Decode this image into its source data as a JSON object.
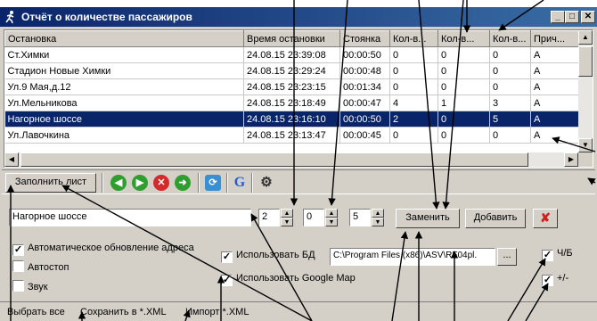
{
  "window": {
    "title": "Отчёт о количестве пассажиров"
  },
  "grid": {
    "columns": [
      "Остановка",
      "Время остановки",
      "Стоянка",
      "Кол-в...",
      "Кол-в...",
      "Кол-в...",
      "Прич..."
    ],
    "rows": [
      [
        "Ст.Химки",
        "24.08.15 23:39:08",
        "00:00:50",
        "0",
        "0",
        "0",
        "A"
      ],
      [
        "Стадион Новые Химки",
        "24.08.15 23:29:24",
        "00:00:48",
        "0",
        "0",
        "0",
        "A"
      ],
      [
        "Ул.9 Мая,д.12",
        "24.08.15 23:23:15",
        "00:01:34",
        "0",
        "0",
        "0",
        "A"
      ],
      [
        "Ул.Мельникова",
        "24.08.15 23:18:49",
        "00:00:47",
        "4",
        "1",
        "3",
        "A"
      ],
      [
        "Нагорное шоссе",
        "24.08.15 23:16:10",
        "00:00:50",
        "2",
        "0",
        "5",
        "A"
      ],
      [
        "Ул.Лавочкина",
        "24.08.15 23:13:47",
        "00:00:45",
        "0",
        "0",
        "0",
        "A"
      ]
    ],
    "selected_row": 4
  },
  "toolbar": {
    "fill_sheet_label": "Заполнить лист",
    "google_letter": "G"
  },
  "form": {
    "stop_name": "Нагорное шоссе",
    "spin1": "2",
    "spin2": "0",
    "spin3": "5",
    "replace_label": "Заменить",
    "add_label": "Добавить",
    "delete_glyph": "✘",
    "db_path": "C:\\Program Files (x86)\\ASV\\RF04pl.",
    "browse_label": "..."
  },
  "options": {
    "auto_update": {
      "label": "Автоматическое обновление адреса",
      "checked": true
    },
    "autostop": {
      "label": "Автостоп",
      "checked": false
    },
    "sound": {
      "label": "Звук",
      "checked": false
    },
    "use_db": {
      "label": "Использовать БД",
      "checked": true
    },
    "use_google_map": {
      "label": "Использовать Google Map",
      "checked": true
    },
    "bw": {
      "label": "Ч/Б",
      "checked": true
    },
    "plus_minus": {
      "label": "+/-",
      "checked": true
    }
  },
  "status": {
    "select_all": "Выбрать все",
    "save_xml": "Сохранить в *.XML",
    "import_xml": "Импорт *.XML"
  },
  "colors": {
    "title_bg": "#0a246a",
    "selection": "#0a246a",
    "face": "#d4d0c8"
  }
}
